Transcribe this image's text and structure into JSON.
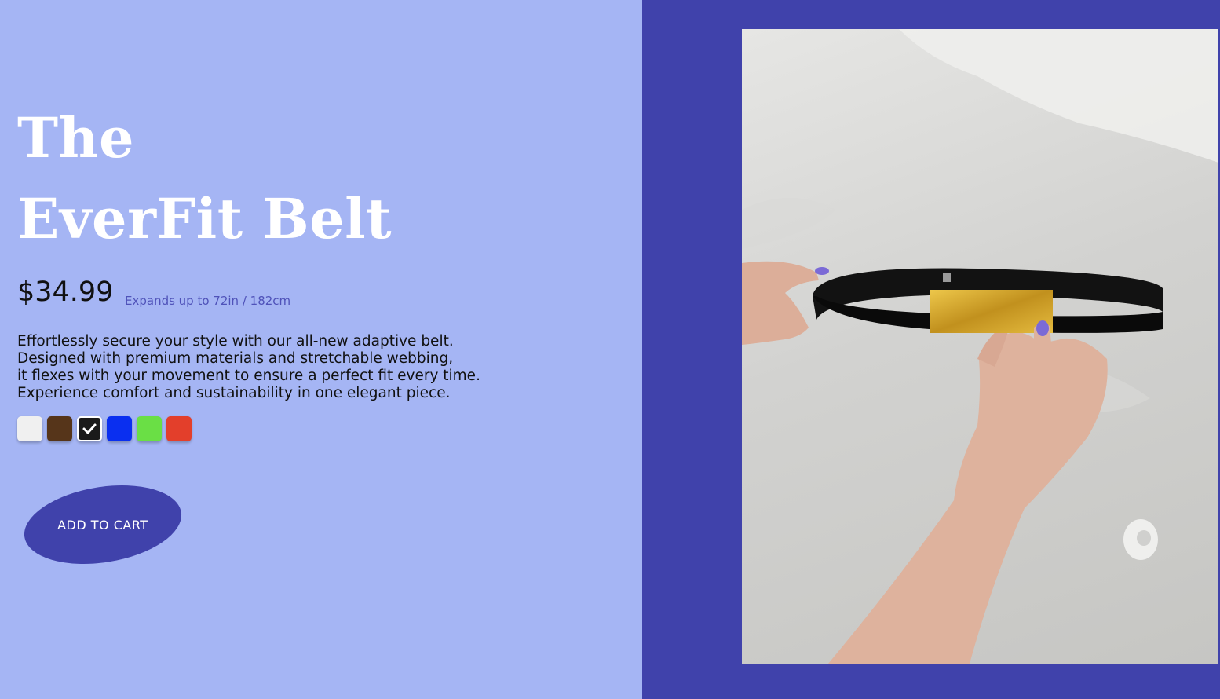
{
  "product": {
    "title_line1": "The",
    "title_line2": "EverFit Belt",
    "price": "$34.99",
    "size_note": "Expands up to 72in / 182cm",
    "description": [
      "Effortlessly secure your style with our all-new adaptive belt.",
      "Designed with premium materials and stretchable webbing,",
      "it flexes with your movement to ensure a perfect fit every time.",
      "Experience comfort and sustainability in one elegant piece."
    ]
  },
  "colors": {
    "options": [
      "#f0f0f0",
      "#56351a",
      "#1a1a1a",
      "#0a2ff0",
      "#6adf45",
      "#e33f2b"
    ],
    "selected_index": 2,
    "left_background": "#a5b5f4",
    "accent": "#4042ab"
  },
  "actions": {
    "add_to_cart_label": "ADD TO CART"
  },
  "image": {
    "icon": "product-photo-belt"
  }
}
